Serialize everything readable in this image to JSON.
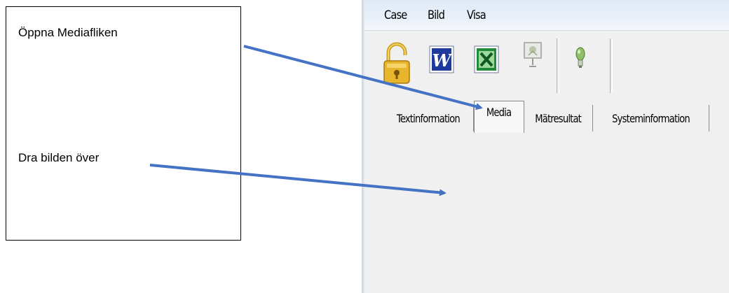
{
  "instructions": {
    "step1": "Öppna Mediafliken",
    "step2": "Dra bilden över"
  },
  "menu": [
    "Case",
    "Bild",
    "Visa"
  ],
  "toolbar": {
    "icons": [
      "lock-icon",
      "word-icon",
      "excel-icon",
      "presentation-icon",
      "lightbulb-icon"
    ]
  },
  "tabs": [
    {
      "label": "Textinformation",
      "active": false
    },
    {
      "label": "Media",
      "active": true
    },
    {
      "label": "Mätresultat",
      "active": false
    },
    {
      "label": "Systeminformation",
      "active": false
    }
  ],
  "colors": {
    "arrow": "#4472c4",
    "menubar": "#e3ebf6",
    "panel": "#f0f0f0"
  }
}
